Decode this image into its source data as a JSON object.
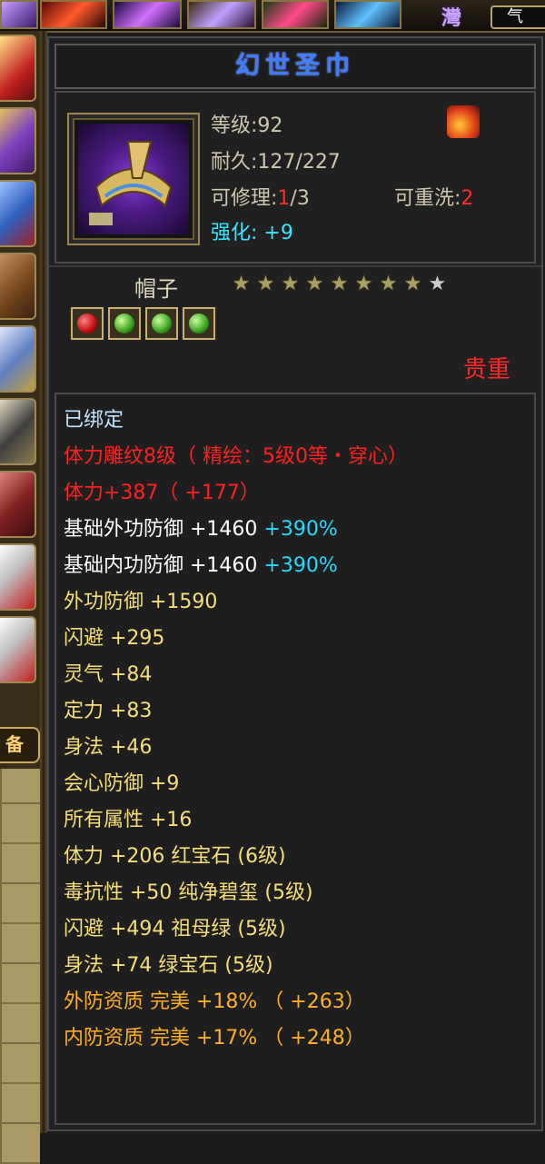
{
  "top_tab": {
    "label": "气"
  },
  "brand_glyph": "灣",
  "left_panel": {
    "tab_label": "备"
  },
  "item": {
    "name": "幻世圣巾",
    "level_label": "等级:92",
    "durability_label": "耐久:127/227",
    "repair_prefix": "可修理:",
    "repair_current": "1",
    "repair_suffix": "/3",
    "rewash_prefix": "可重洗:",
    "rewash_value": "2",
    "enhance_prefix": "强化: ",
    "enhance_value": "+9",
    "type": "帽子",
    "stars_total": 9,
    "stars_lit": 8,
    "quality_text": "贵重",
    "gems": [
      "red",
      "green",
      "green",
      "green"
    ]
  },
  "attributes": {
    "bound": "已绑定",
    "engrave": "体力雕纹8级（ 精绘：5级0等・穿心）",
    "stamina": "体力+387（ +177）",
    "base_ext_def_a": "基础外功防御 +1460 ",
    "base_ext_def_b": "+390%",
    "base_int_def_a": "基础内功防御 +1460 ",
    "base_int_def_b": "+390%",
    "ext_def": "外功防御 +1590",
    "dodge": "闪避 +295",
    "spirit": "灵气 +84",
    "focus": "定力 +83",
    "agility": "身法 +46",
    "crit_def": "会心防御 +9",
    "all_attr": "所有属性 +16",
    "gem_1": "体力 +206 红宝石 (6级)",
    "gem_2": "毒抗性 +50 纯净碧玺 (5级)",
    "gem_3": "闪避 +494 祖母绿 (5级)",
    "gem_4": "身法 +74 绿宝石 (5级)",
    "ext_aptitude": "外防资质   完美 +18% （ +263）",
    "int_aptitude": "内防资质   完美 +17% （ +248）"
  }
}
